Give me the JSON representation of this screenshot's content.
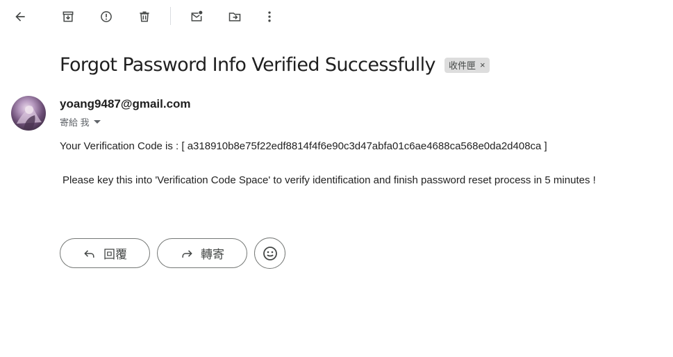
{
  "toolbar": {
    "icons": [
      "back-icon",
      "archive-icon",
      "report-spam-icon",
      "delete-icon",
      "mark-unread-icon",
      "move-to-icon",
      "more-vert-icon"
    ]
  },
  "email": {
    "subject": "Forgot Password Info Verified Successfully",
    "label": "收件匣",
    "label_remove": "×",
    "sender": "yoang9487@gmail.com",
    "to": "寄給 我",
    "body_line1": "Your Verification Code is : [ a318910b8e75f22edf8814f4f6e90c3d47abfa01c6ae4688ca568e0da2d408ca ]",
    "body_line2": "Please key this into 'Verification Code Space' to verify identification and finish password reset process in 5 minutes !"
  },
  "actions": {
    "reply_label": "回覆",
    "forward_label": "轉寄"
  }
}
